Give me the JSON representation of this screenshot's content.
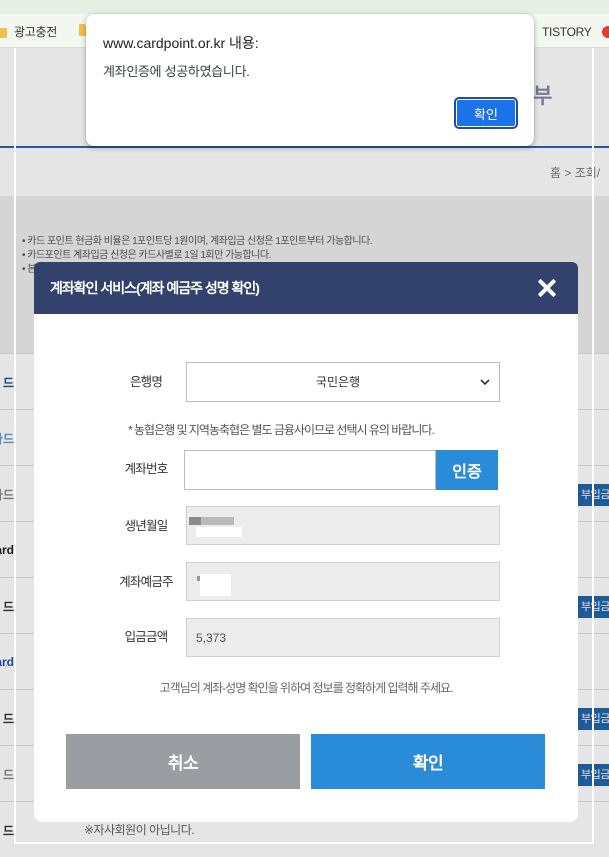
{
  "colors": {
    "modal_header": "#33426c",
    "primary": "#2a8bd8",
    "cancel": "#9a9ea3",
    "alert_button": "#1a73e8",
    "row_button": "#2265aa",
    "header_line": "#2a62aa"
  },
  "bookmarks": [
    {
      "label": "광고충전",
      "icon": "folder-icon"
    },
    {
      "icon": "folder-icon"
    },
    {
      "label": "TISTORY"
    },
    {
      "icon": "red-circle-favicon-icon"
    }
  ],
  "alert": {
    "origin": "www.cardpoint.or.kr 내용:",
    "message": "계좌인증에 성공하였습니다.",
    "ok_label": "확인"
  },
  "page": {
    "title_fragment": "부",
    "breadcrumb": "홈 > 조회/",
    "notices": [
      "카드 포인트 현금화 비율은 1포인트당 1원이며, 계좌입금 신청은 1포인트부터 가능합니다.",
      "카드포인트 계좌입금 신청은 카드사별로 1일 1회만 가능합니다.",
      "본"
    ],
    "rows": [
      {
        "card": "드",
        "color": "#1f4d94",
        "has_button": false
      },
      {
        "card": "카드",
        "color": "#6a9ad0",
        "has_button": false
      },
      {
        "card": "카드",
        "color": "#8a8a8a",
        "has_button": true
      },
      {
        "card": "ard",
        "color": "#222222",
        "has_button": false
      },
      {
        "card": "드",
        "color": "#333333",
        "has_button": true
      },
      {
        "card": "ard",
        "color": "#1f4fb0",
        "has_button": false
      },
      {
        "card": "드",
        "color": "#333333",
        "has_button": true
      },
      {
        "card": "드",
        "color": "#888888",
        "has_button": true
      },
      {
        "card": "드",
        "color": "#333333",
        "has_button": false
      }
    ],
    "row_button_label": "부입금",
    "footer_note": "※자사회원이 아닙니다."
  },
  "modal": {
    "title": "계좌확인 서비스(계좌 예금주 성명 확인)",
    "bank_label": "은행명",
    "bank_value": "국민은행",
    "bank_note": "* 농협은행 및 지역농축협은 별도 금융사이므로 선택시 유의 바랍니다.",
    "account_label": "계좌번호",
    "verify_label": "인증",
    "birth_label": "생년월일",
    "holder_label": "계좌예금주",
    "amount_label": "입금금액",
    "amount_value": "5,373",
    "guide": "고객님의 계좌-성명 확인을 위하여 정보를 정확하게 입력해 주세요.",
    "cancel_label": "취소",
    "confirm_label": "확인"
  }
}
